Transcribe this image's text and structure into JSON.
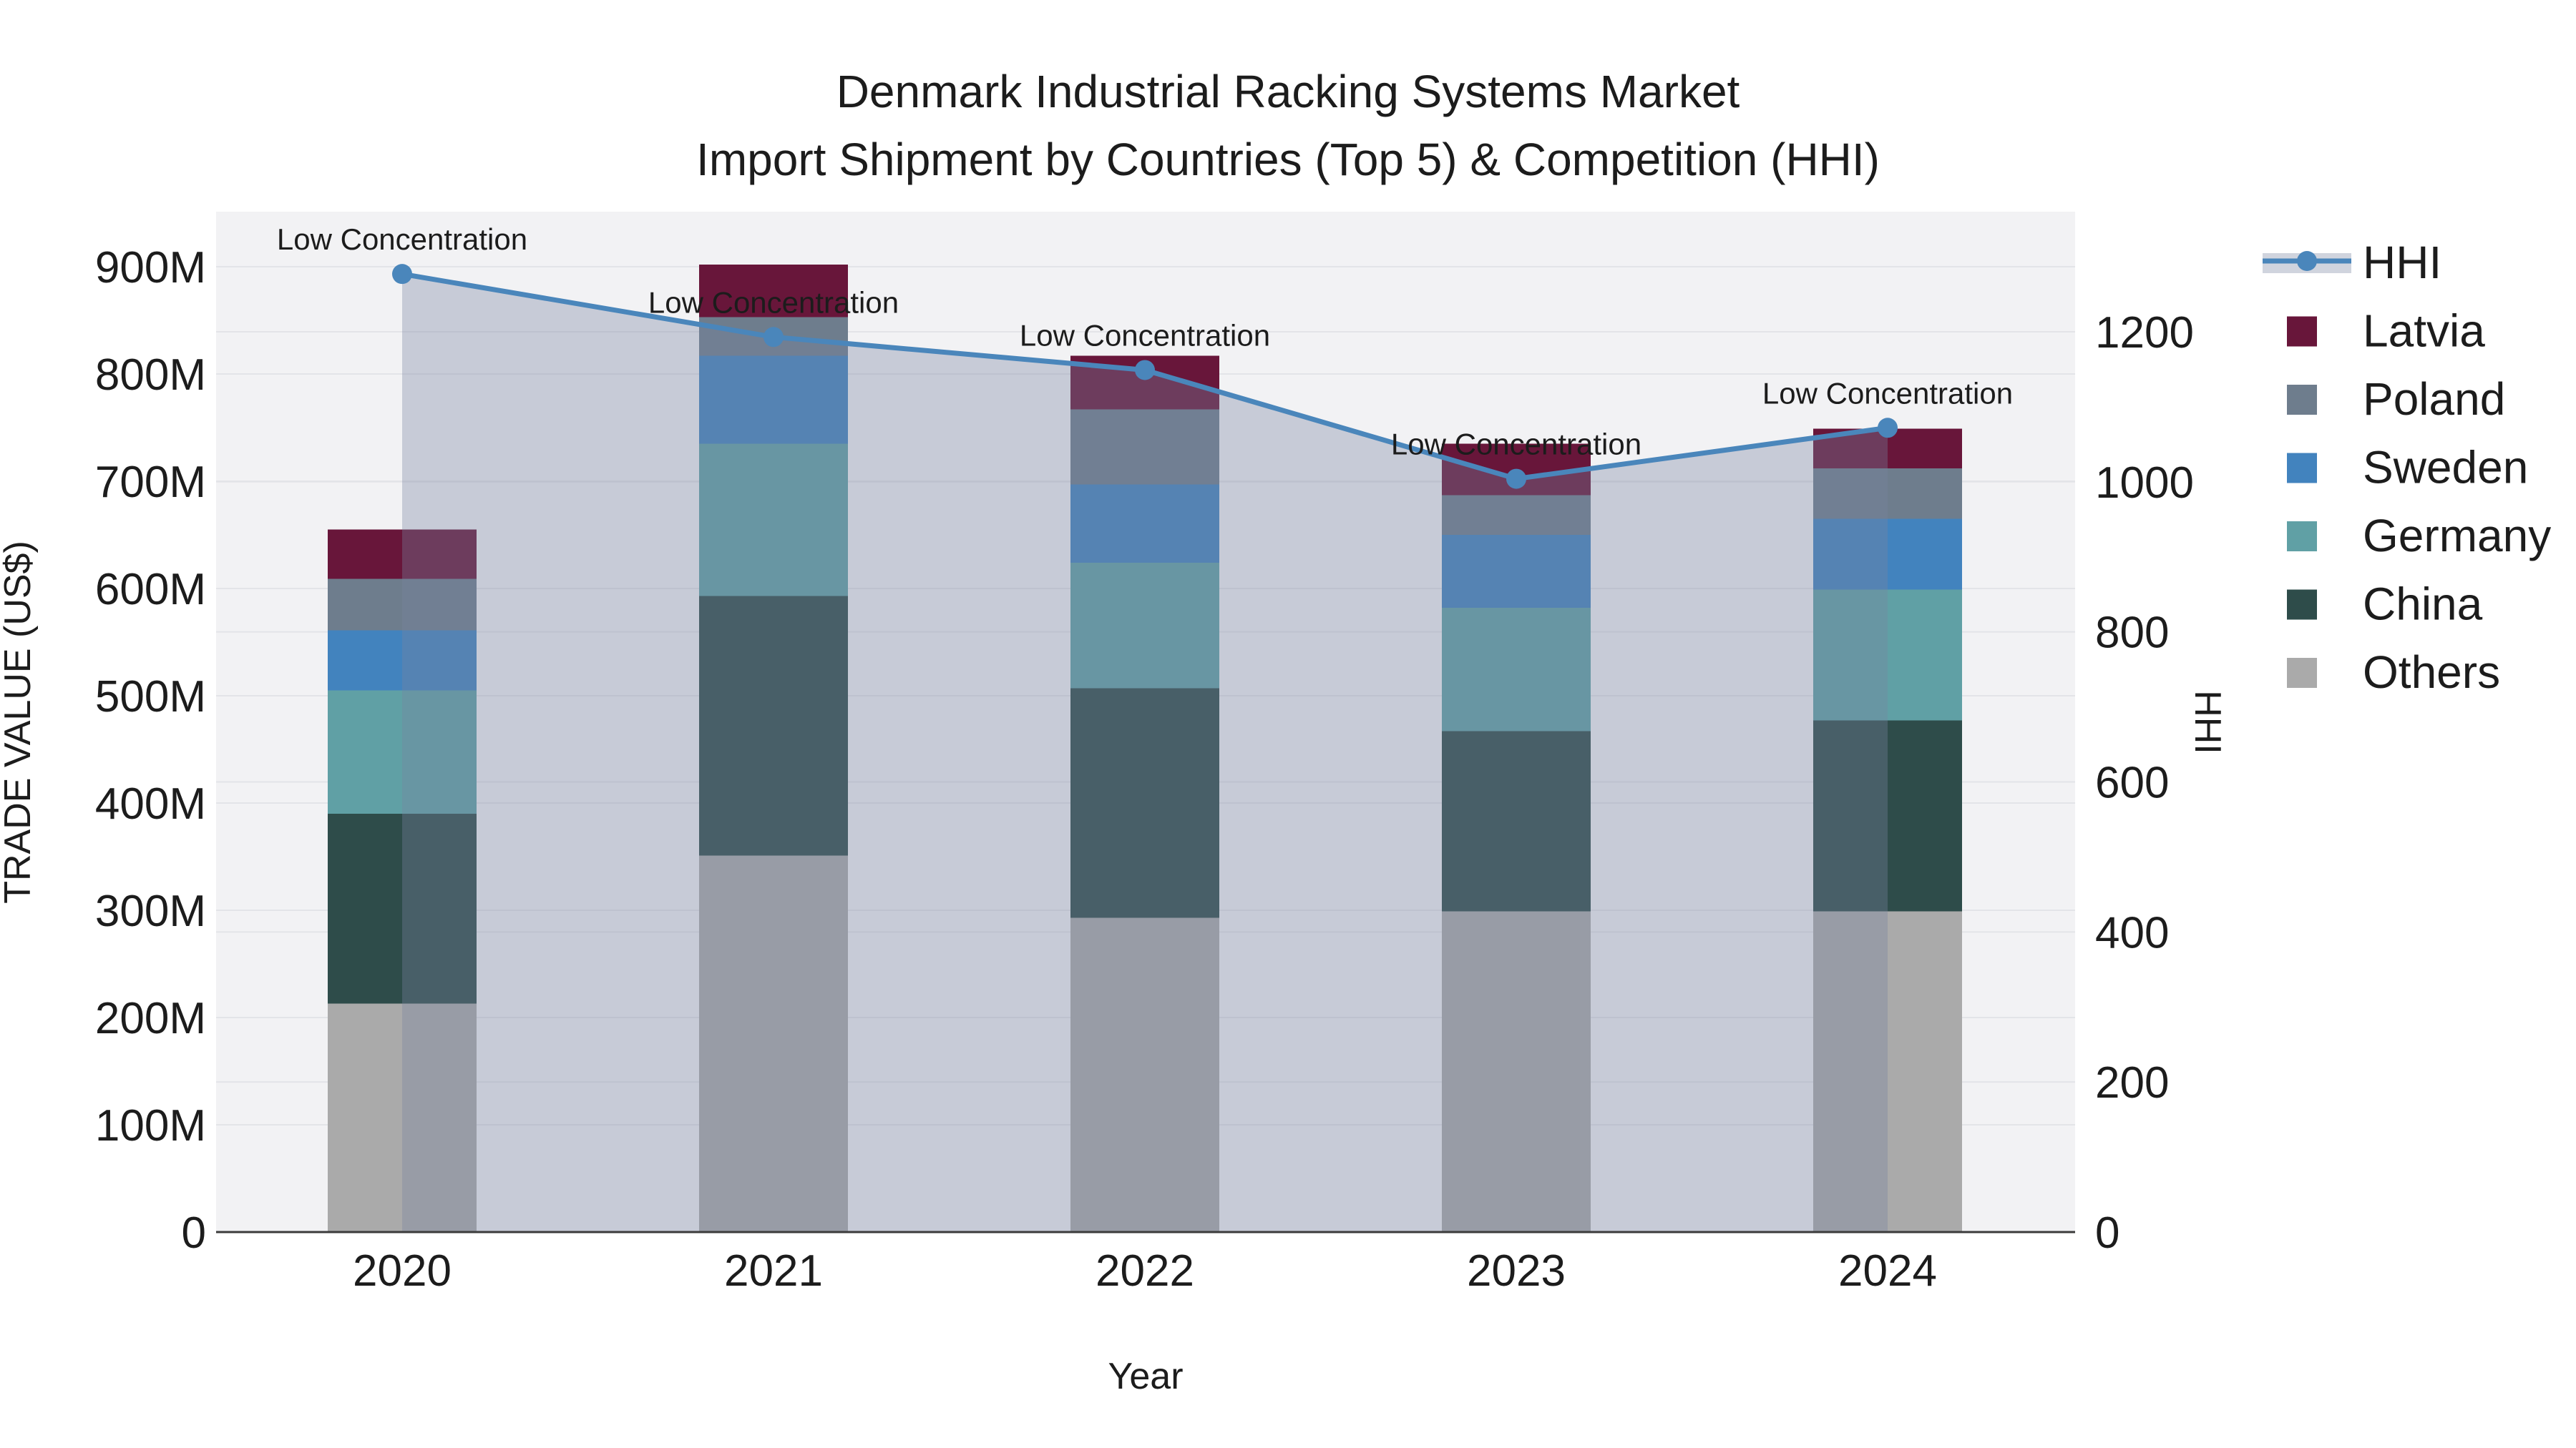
{
  "chart_data": {
    "type": "bar",
    "subtype": "stacked-bars-with-hhi-line-area",
    "title": "Denmark Industrial Racking Systems Market",
    "subtitle": "Import Shipment by Countries (Top 5) & Competition (HHI)",
    "xlabel": "Year",
    "ylabel_left": "TRADE VALUE (US$)",
    "ylabel_right": "HHI",
    "categories": [
      "2020",
      "2021",
      "2022",
      "2023",
      "2024"
    ],
    "stack_order_bottom_to_top": [
      "Others",
      "China",
      "Germany",
      "Sweden",
      "Poland",
      "Latvia"
    ],
    "series": [
      {
        "name": "Others",
        "color": "#AAAAAA",
        "values_musd": [
          213,
          351,
          293,
          299,
          299
        ]
      },
      {
        "name": "China",
        "color": "#2E4C4A",
        "values_musd": [
          177,
          242,
          214,
          168,
          178
        ]
      },
      {
        "name": "Germany",
        "color": "#60A0A5",
        "values_musd": [
          115,
          142,
          117,
          115,
          122
        ]
      },
      {
        "name": "Sweden",
        "color": "#4283BE",
        "values_musd": [
          56,
          82,
          73,
          68,
          66
        ]
      },
      {
        "name": "Poland",
        "color": "#6E7D8D",
        "values_musd": [
          48,
          36,
          70,
          37,
          47
        ]
      },
      {
        "name": "Latvia",
        "color": "#68163A",
        "values_musd": [
          46,
          49,
          50,
          48,
          37
        ]
      }
    ],
    "bar_totals_musd": [
      655,
      902,
      817,
      735,
      749
    ],
    "hhi_line": {
      "name": "HHI",
      "values": [
        1277,
        1193,
        1149,
        1004,
        1072
      ],
      "line_color": "#4A86BB",
      "area_fill": "rgba(120,133,160,0.35)"
    },
    "annotations": [
      "Low Concentration",
      "Low Concentration",
      "Low Concentration",
      "Low Concentration",
      "Low Concentration"
    ],
    "y_left_axis": {
      "min": 0,
      "tick_step_musd": 100,
      "tick_labels": [
        "0",
        "100M",
        "200M",
        "300M",
        "400M",
        "500M",
        "600M",
        "700M",
        "800M",
        "900M"
      ]
    },
    "y_right_axis": {
      "min": 0,
      "tick_step": 200,
      "tick_labels": [
        "0",
        "200",
        "400",
        "600",
        "800",
        "1000",
        "1200"
      ]
    },
    "legend_order": [
      "HHI",
      "Latvia",
      "Poland",
      "Sweden",
      "Germany",
      "China",
      "Others"
    ],
    "grid": true,
    "plot_background": "#F2F2F4",
    "gridline_color": "#E3E4E8",
    "axis_line_color": "#3B3B3B"
  }
}
